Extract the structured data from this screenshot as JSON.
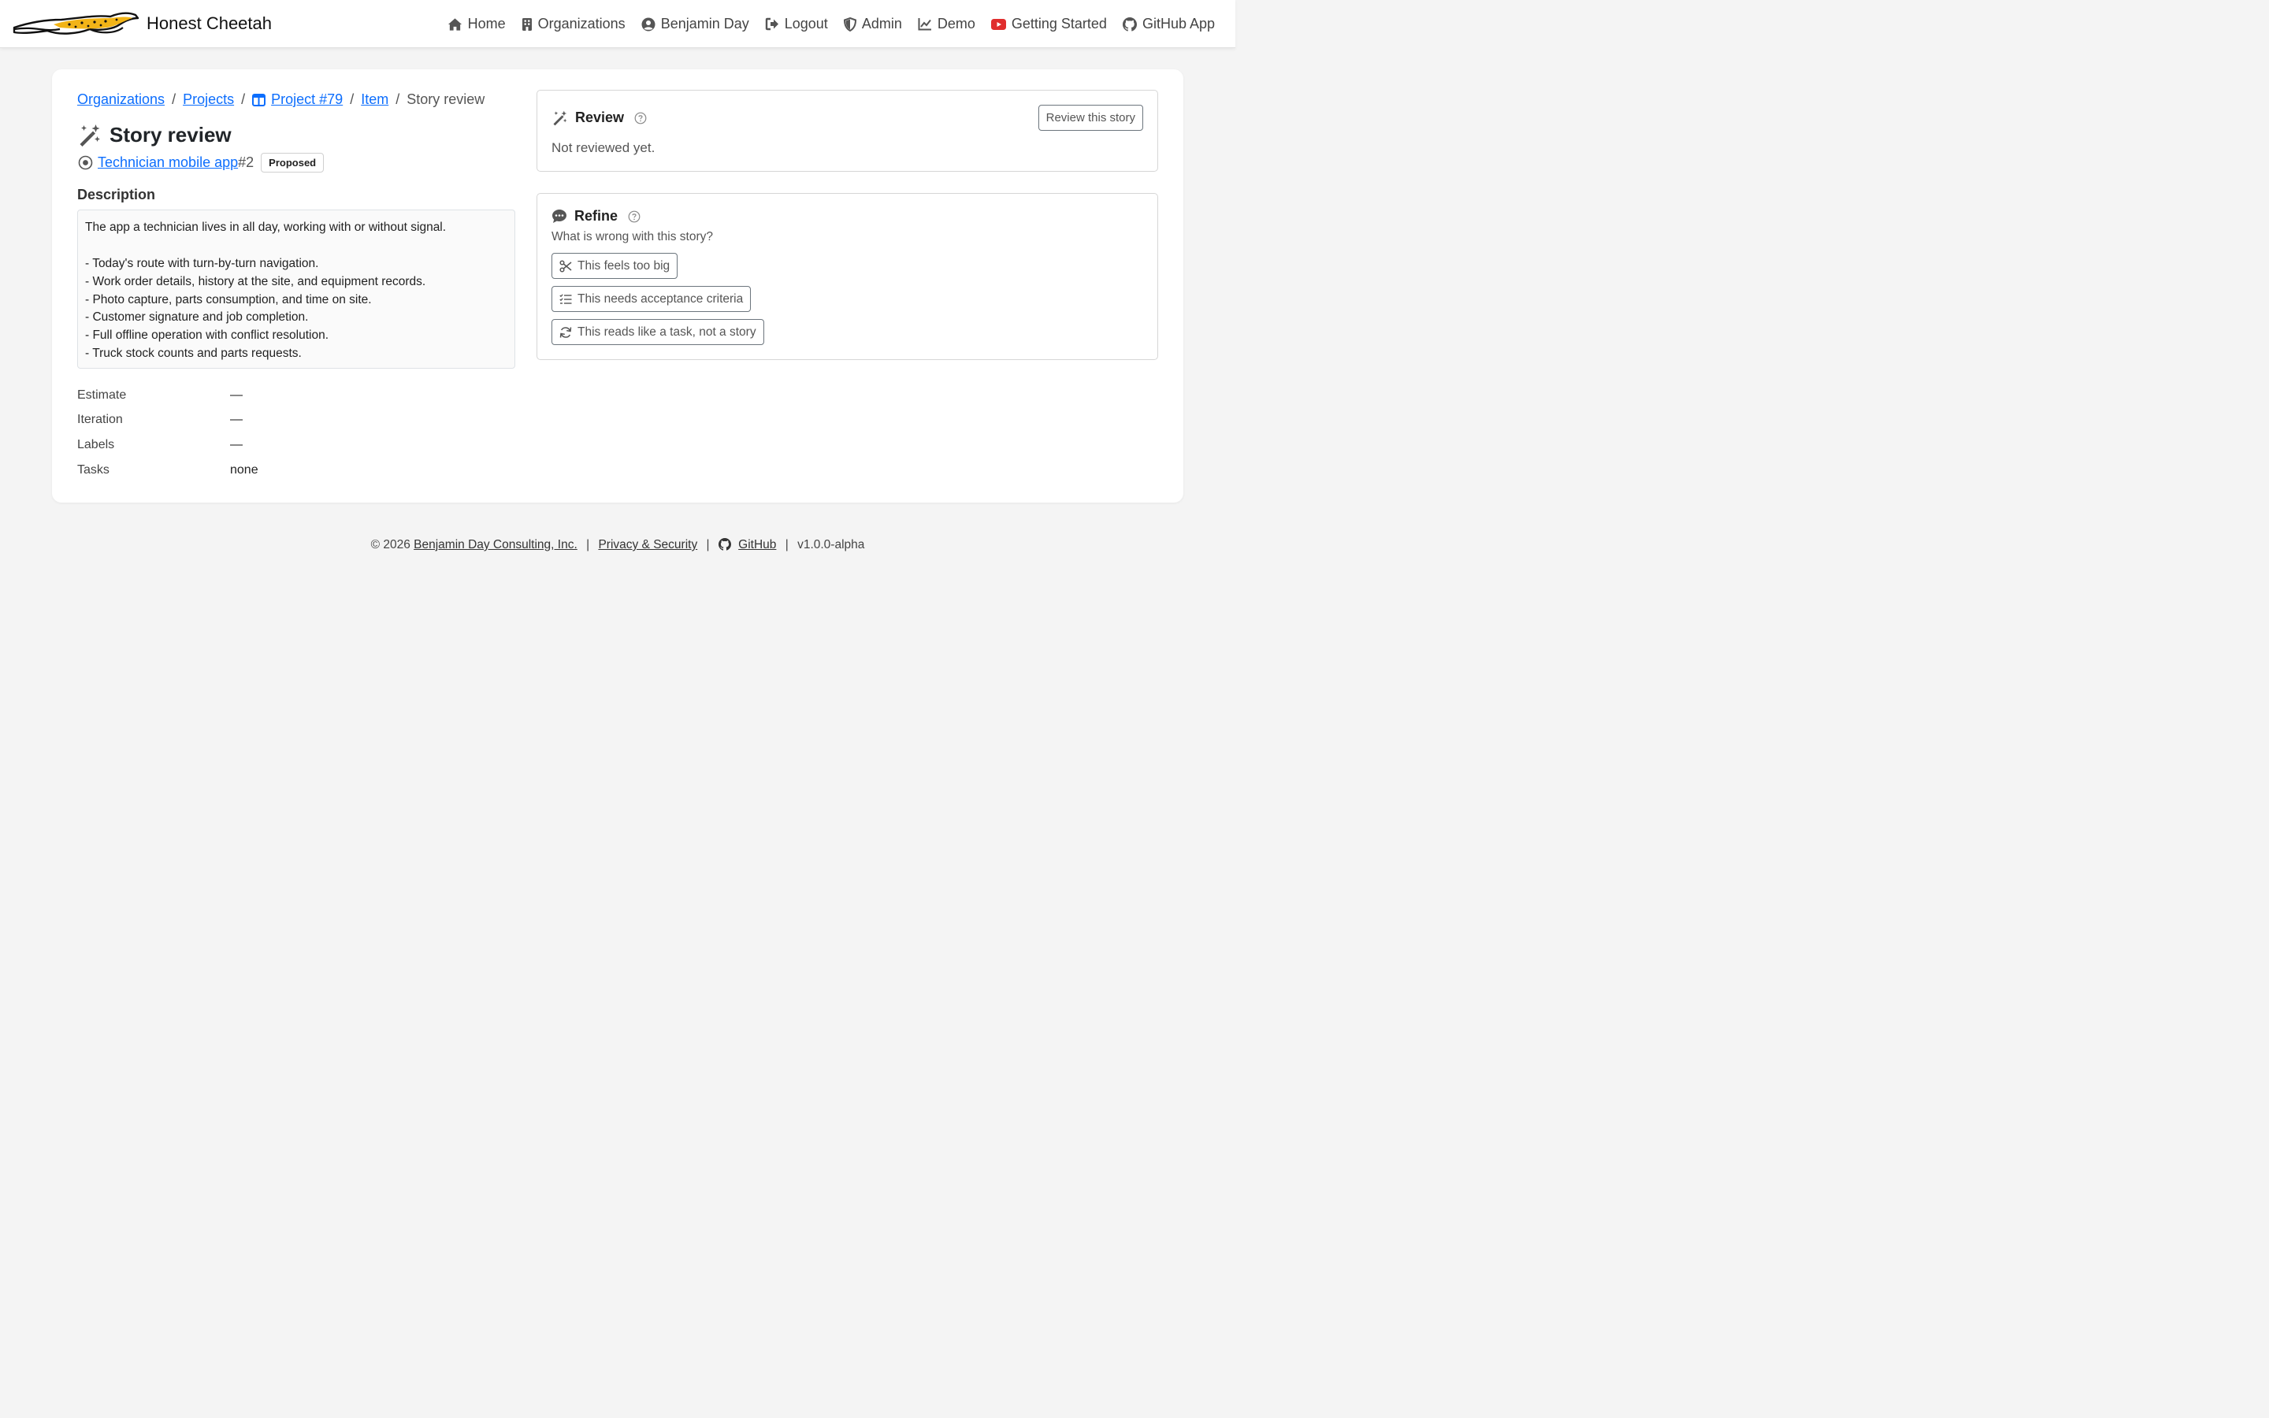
{
  "nav": {
    "brand": "Honest Cheetah",
    "items": [
      {
        "label": "Home",
        "icon": "home-icon"
      },
      {
        "label": "Organizations",
        "icon": "building-icon"
      },
      {
        "label": "Benjamin Day",
        "icon": "user-circle-icon"
      },
      {
        "label": "Logout",
        "icon": "logout-icon"
      },
      {
        "label": "Admin",
        "icon": "shield-icon"
      },
      {
        "label": "Demo",
        "icon": "chart-line-icon"
      },
      {
        "label": "Getting Started",
        "icon": "youtube-icon"
      },
      {
        "label": "GitHub App",
        "icon": "github-icon"
      }
    ]
  },
  "breadcrumb": {
    "organizations": "Organizations",
    "projects": "Projects",
    "project": "Project #79",
    "item": "Item",
    "current": "Story review",
    "separator": "/"
  },
  "page": {
    "title": "Story review",
    "parent_link": "Technician mobile app",
    "parent_number": "#2",
    "status_badge": "Proposed"
  },
  "description": {
    "label": "Description",
    "lines": [
      "The app a technician lives in all day, working with or without signal.",
      "",
      "- Today's route with turn-by-turn navigation.",
      "- Work order details, history at the site, and equipment records.",
      "- Photo capture, parts consumption, and time on site.",
      "- Customer signature and job completion.",
      "- Full offline operation with conflict resolution.",
      "- Truck stock counts and parts requests."
    ]
  },
  "meta": [
    {
      "key": "Estimate",
      "value": "—"
    },
    {
      "key": "Iteration",
      "value": "—"
    },
    {
      "key": "Labels",
      "value": "—"
    },
    {
      "key": "Tasks",
      "value": "none"
    }
  ],
  "review": {
    "title": "Review",
    "button": "Review this story",
    "status": "Not reviewed yet."
  },
  "refine": {
    "title": "Refine",
    "question": "What is wrong with this story?",
    "buttons": [
      {
        "label": "This feels too big",
        "icon": "scissors-icon"
      },
      {
        "label": "This needs acceptance criteria",
        "icon": "checklist-icon"
      },
      {
        "label": "This reads like a task, not a story",
        "icon": "refresh-icon"
      }
    ]
  },
  "footer": {
    "copyright": "© 2026",
    "company": "Benjamin Day Consulting, Inc.",
    "privacy": "Privacy & Security",
    "github": "GitHub",
    "version": "v1.0.0-alpha"
  },
  "colors": {
    "link": "#0d6efd",
    "brand_accent": "#f2b417",
    "youtube": "#e02d2d"
  }
}
